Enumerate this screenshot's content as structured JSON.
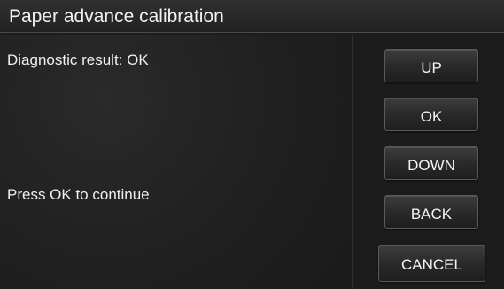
{
  "title_bar": {
    "title": "Paper advance calibration"
  },
  "content": {
    "result_text": "Diagnostic result: OK",
    "continue_text": "Press OK to continue"
  },
  "buttons": {
    "up": "UP",
    "ok": "OK",
    "down": "DOWN",
    "back": "BACK",
    "cancel": "CANCEL"
  }
}
